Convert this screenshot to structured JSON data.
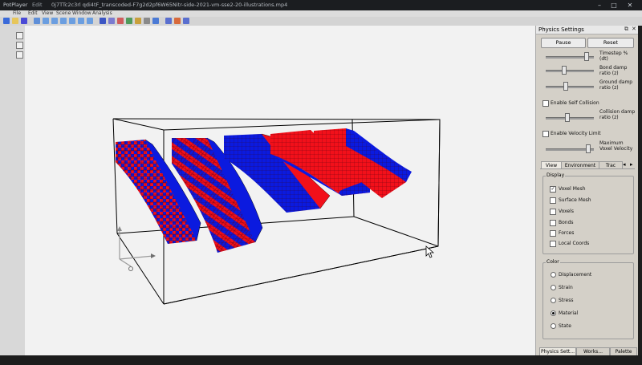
{
  "titlebar": {
    "app_name": "PotPlayer",
    "menu_label": "Edit",
    "file_name": "0j7TTc2c3rl qdi4tF_transcoded-F7g2d2pf6W65Nitr-side-2021-vm-sse2-20-illustrations.mp4",
    "min_icon": "minimize-icon",
    "max_icon": "maximize-icon",
    "close_icon": "close-icon"
  },
  "menubar": {
    "items": [
      "File",
      "Edit",
      "View",
      "Scene",
      "Window",
      "Analysis"
    ]
  },
  "panel": {
    "title": "Physics Settings",
    "pause_label": "Pause",
    "reset_label": "Reset",
    "timestep_label": "Timestep % (dt)",
    "bond_damp_label": "Bond damp ratio (z)",
    "ground_damp_label": "Ground damp ratio (z)",
    "self_collision_label": "Enable Self Collision",
    "collision_damp_label": "Collision damp ratio (z)",
    "velocity_limit_label": "Enable Velocity Limit",
    "max_velocity_label": "Maximum Voxel Velocity",
    "tabs": [
      "View",
      "Environment",
      "Trac"
    ],
    "display_title": "Display",
    "display_items": [
      {
        "label": "Voxel Mesh",
        "checked": true
      },
      {
        "label": "Surface Mesh",
        "checked": false
      },
      {
        "label": "Voxels",
        "checked": false
      },
      {
        "label": "Bonds",
        "checked": false
      },
      {
        "label": "Forces",
        "checked": false
      },
      {
        "label": "Local Coords",
        "checked": false
      }
    ],
    "color_title": "Color",
    "color_items": [
      {
        "label": "Displacement",
        "selected": false
      },
      {
        "label": "Strain",
        "selected": false
      },
      {
        "label": "Stress",
        "selected": false
      },
      {
        "label": "Material",
        "selected": true
      },
      {
        "label": "State",
        "selected": false
      }
    ],
    "bottom_tabs": [
      "Physics Sett...",
      "Works...",
      "Palette"
    ],
    "check_mark": "✓",
    "tab_arrow_left": "◂",
    "tab_arrow_right": "▸",
    "restore_icon": "restore-icon",
    "close_icon": "close-icon"
  },
  "colors": {
    "material_red": "#f2101a",
    "material_blue": "#0b1adf",
    "background": "#f2f2f2"
  }
}
